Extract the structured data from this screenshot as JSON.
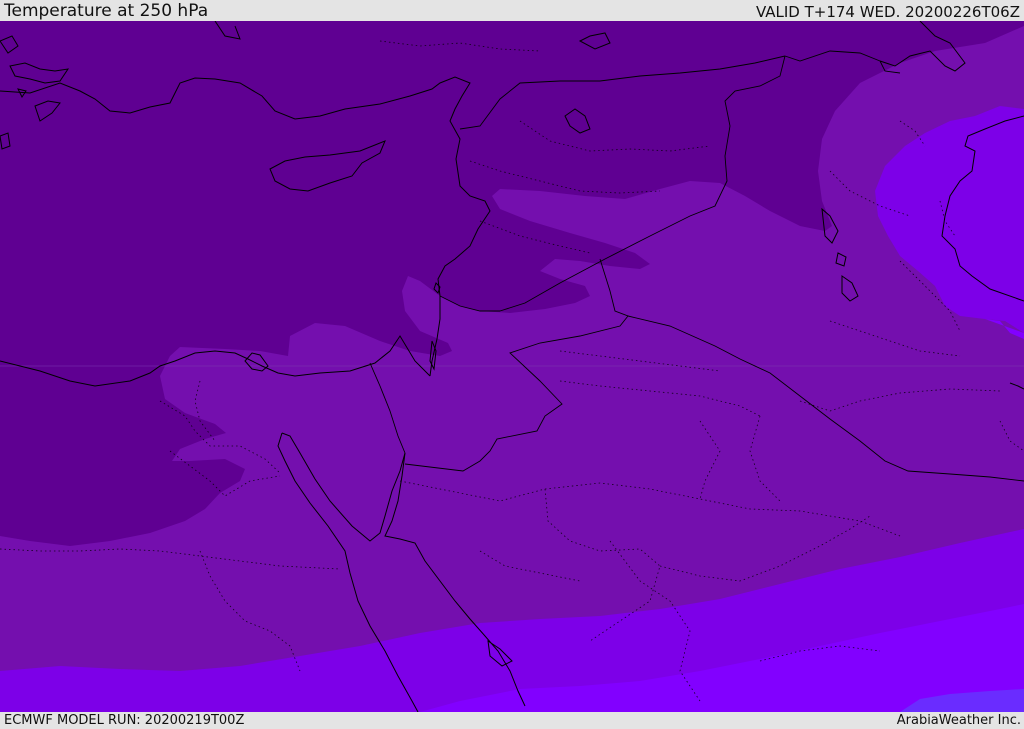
{
  "header": {
    "title": "Temperature at 250 hPa",
    "valid": "VALID T+174 WED. 20200226T06Z"
  },
  "footer": {
    "model_run": "ECMWF MODEL RUN: 20200219T00Z",
    "credit": "ArabiaWeather Inc."
  },
  "map": {
    "variable": "temperature",
    "pressure_level_hpa": 250,
    "colors": {
      "band_coldest": "#5f0092",
      "band_2": "#740fae",
      "band_3": "#7d00e8",
      "band_4": "#8200ff",
      "band_warmest": "#6a2cff",
      "coastline": "#000000",
      "border": "#000000"
    }
  }
}
